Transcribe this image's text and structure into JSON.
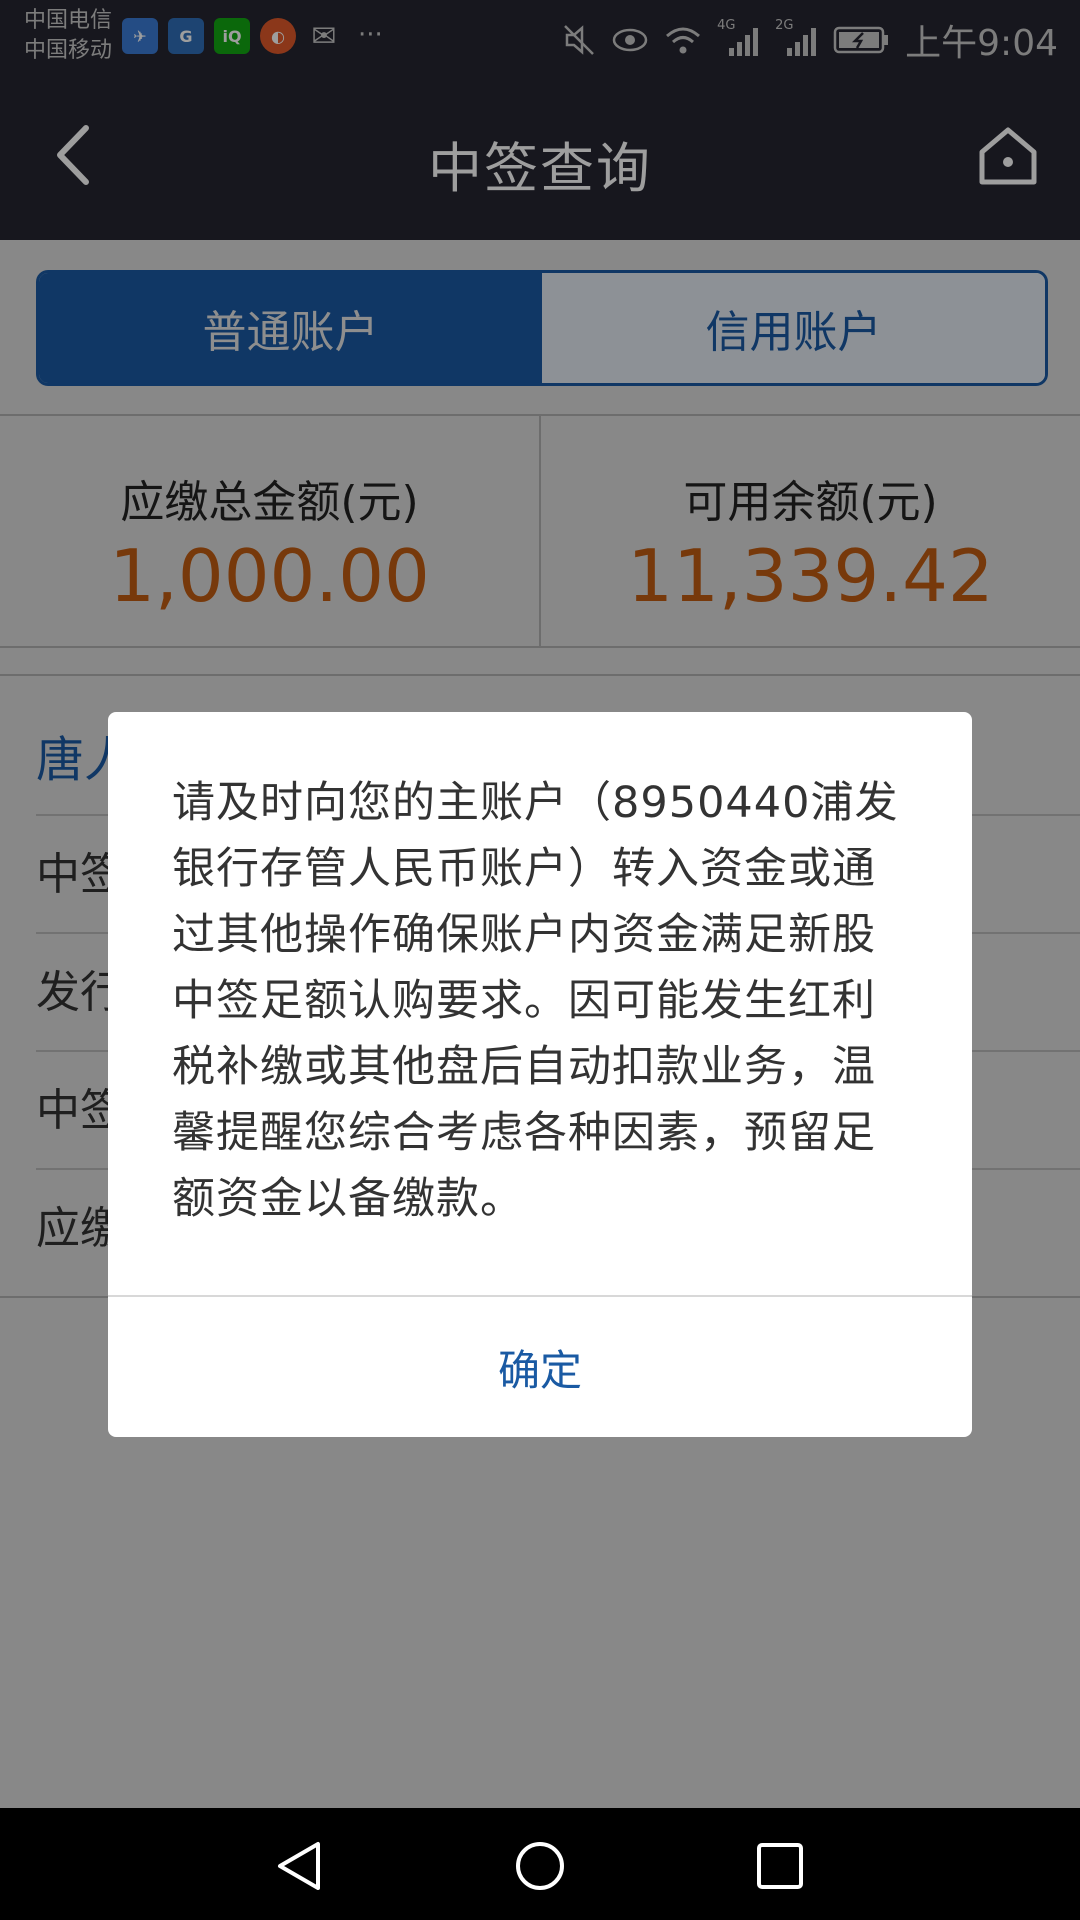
{
  "status_bar": {
    "carrier1": "中国电信",
    "carrier2": "中国移动",
    "network1": "4G",
    "network2": "2G",
    "time": "上午9:04"
  },
  "header": {
    "title": "中签查询"
  },
  "tabs": {
    "normal": "普通账户",
    "credit": "信用账户"
  },
  "totals": {
    "due_label": "应缴总金额(元)",
    "due_value": "1,000.00",
    "available_label": "可用余额(元)",
    "available_value": "11,339.42"
  },
  "list": {
    "head": "唐人",
    "rows": [
      "中签",
      "发行",
      "中签",
      "应缴"
    ]
  },
  "dialog": {
    "message": "请及时向您的主账户（8950440浦发银行存管人民币账户）转入资金或通过其他操作确保账户内资金满足新股中签足额认购要求。因可能发生红利税补缴或其他盘后自动扣款业务，温馨提醒您综合考虑各种因素，预留足额资金以备缴款。",
    "confirm": "确定"
  },
  "colors": {
    "header_bg": "#262631",
    "accent_blue": "#1a5aa3",
    "amount_orange": "#c15c12"
  }
}
